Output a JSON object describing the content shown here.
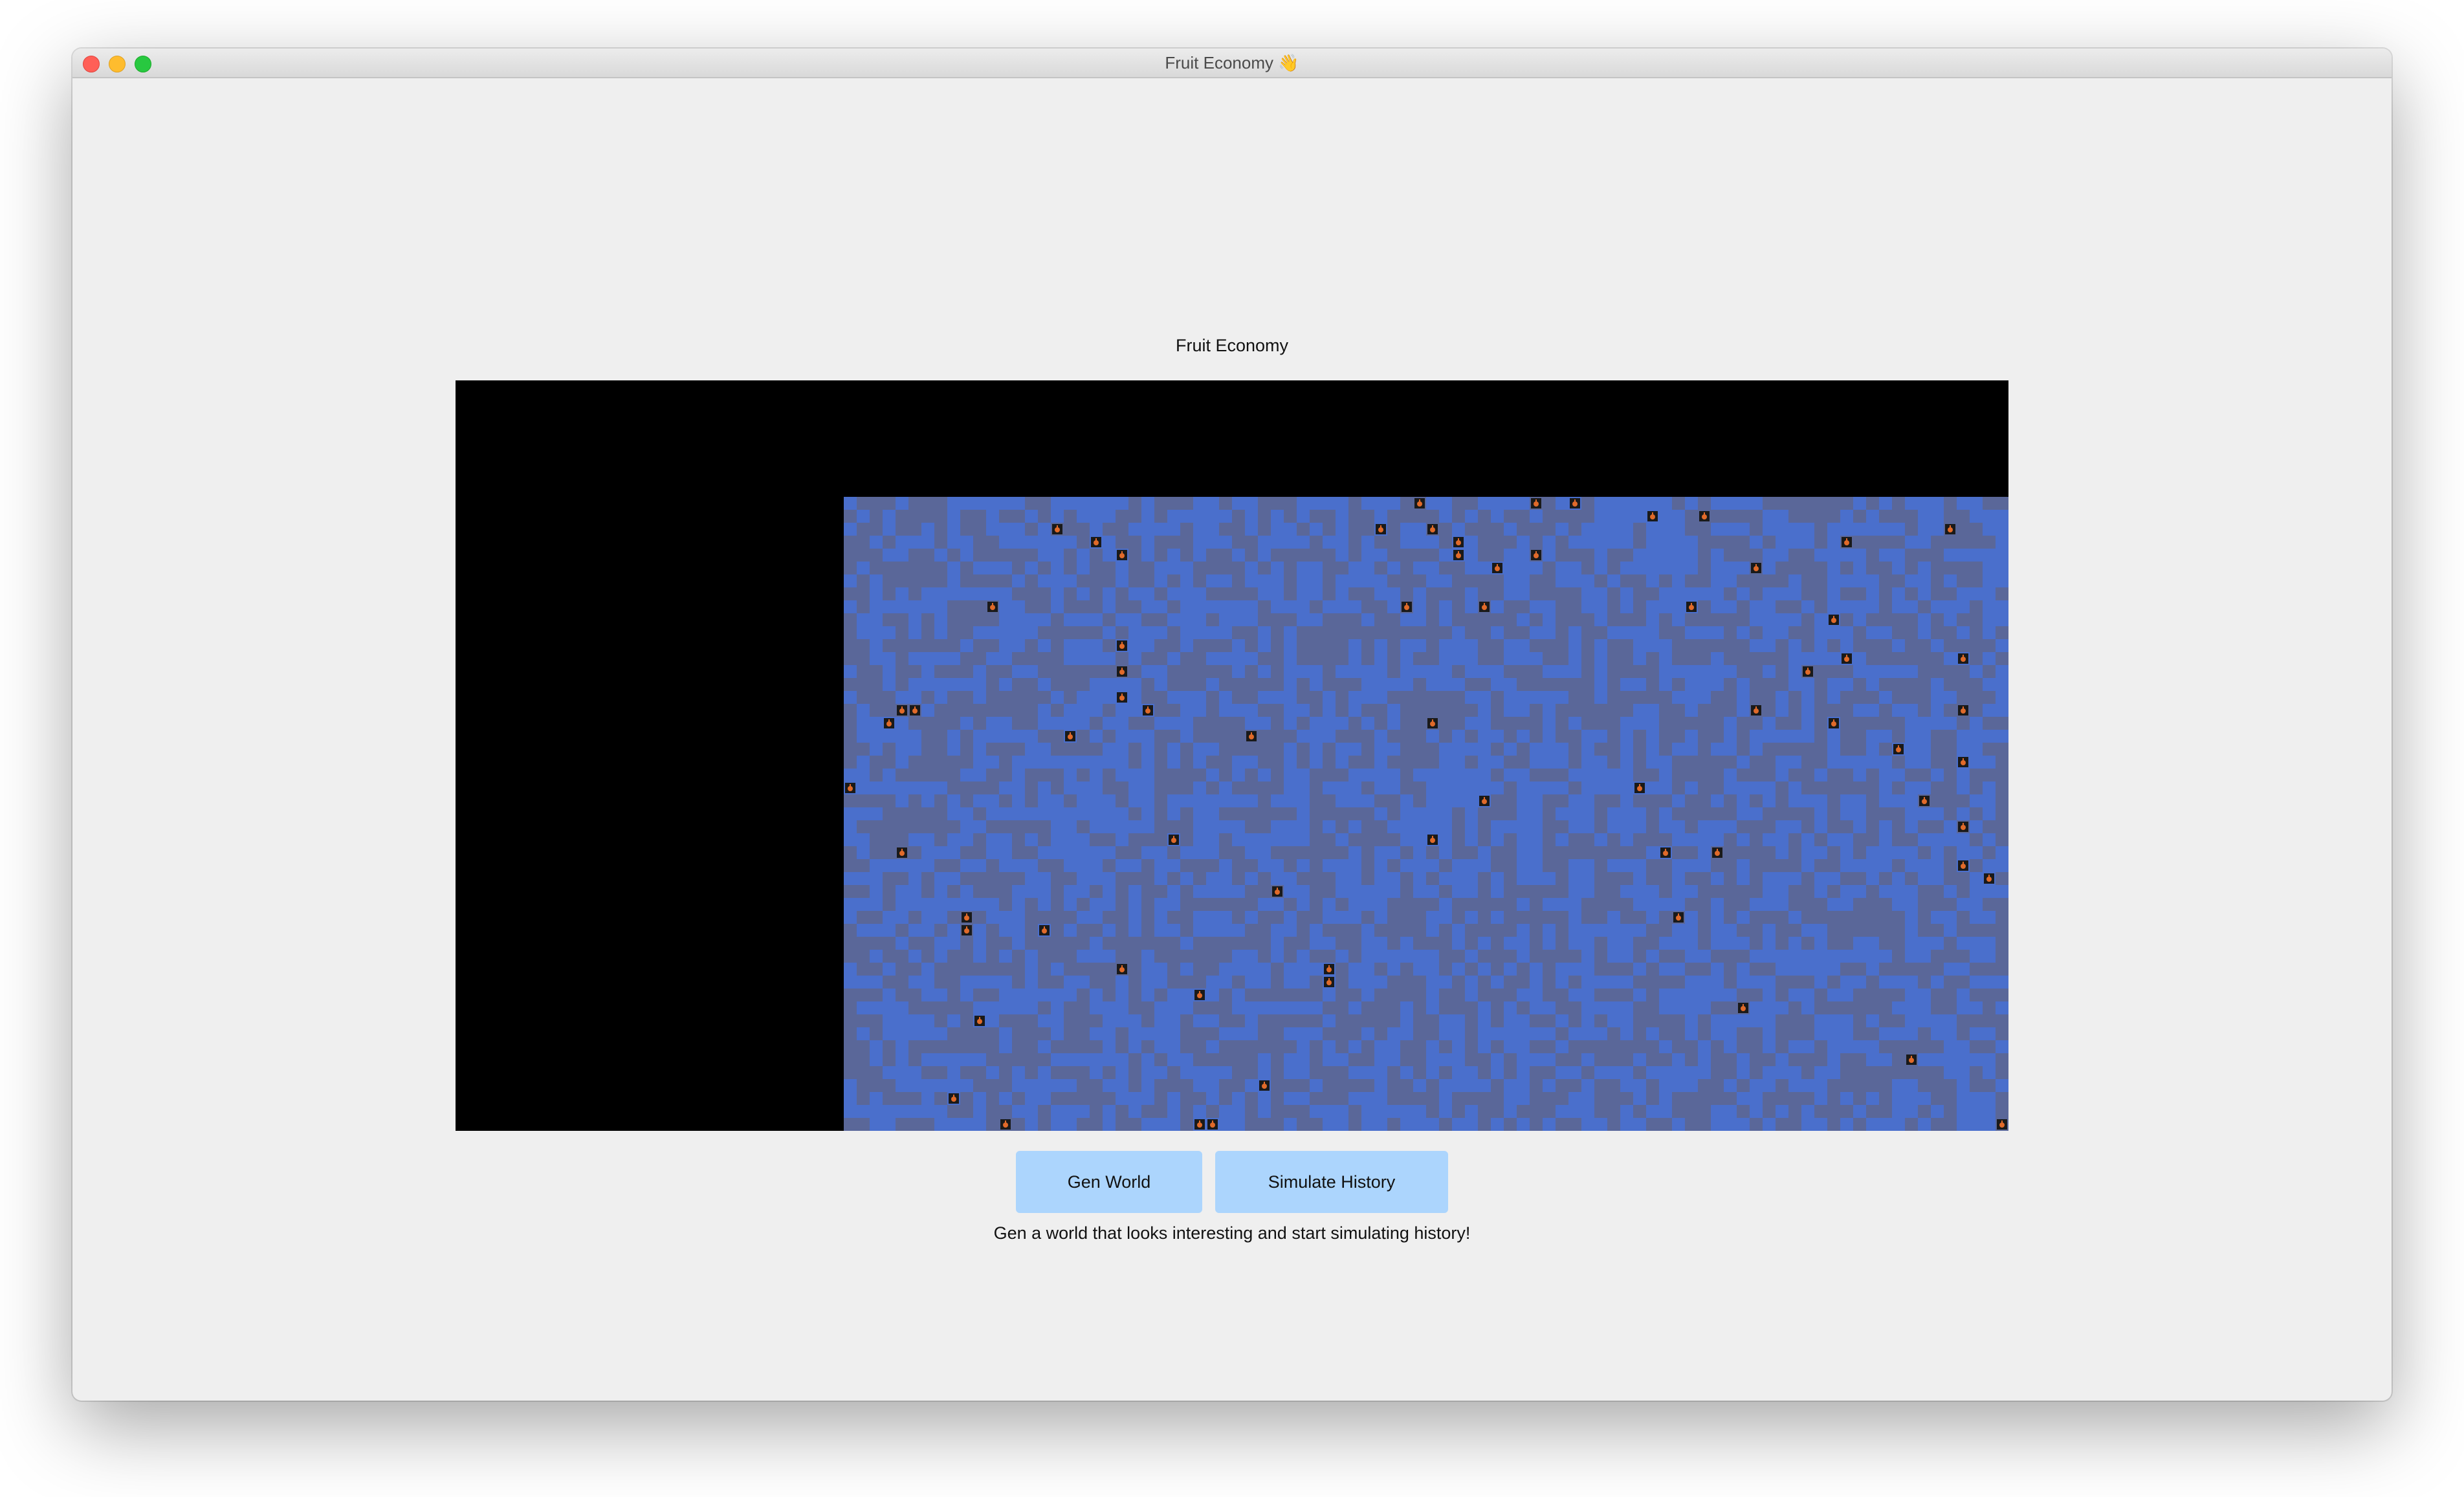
{
  "window": {
    "title": "Fruit Economy 👋"
  },
  "app": {
    "heading": "Fruit Economy",
    "hint": "Gen a world that looks interesting and start simulating history!"
  },
  "buttons": {
    "gen_world": "Gen World",
    "simulate_history": "Simulate History"
  },
  "map": {
    "colors": {
      "canvas_background": "#000000",
      "terrain_a": "#4a6fcc",
      "terrain_b": "#5a6799",
      "marker_fill": "#1a1a1a",
      "marker_glyph": "#e06a2a"
    },
    "marker_icon": "fruit-tree-icon"
  }
}
